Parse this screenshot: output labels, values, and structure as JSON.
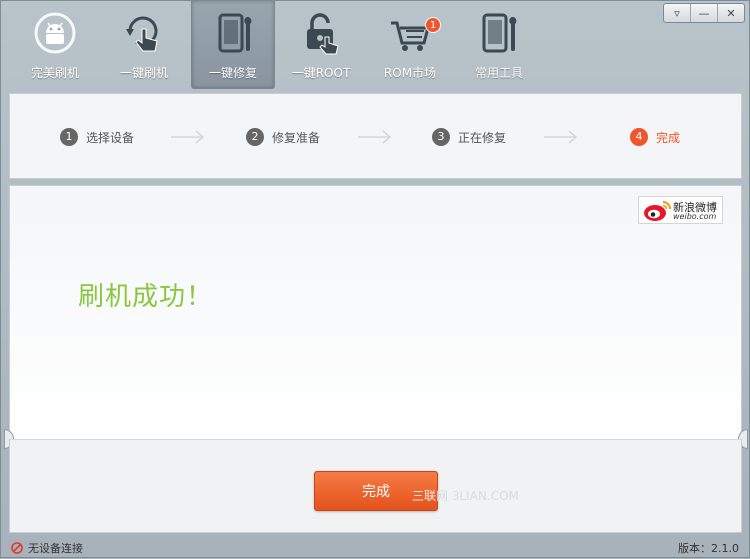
{
  "toolbar": {
    "items": [
      {
        "label": "完美刷机",
        "icon": "android-icon",
        "active": false
      },
      {
        "label": "一键刷机",
        "icon": "touch-refresh-icon",
        "active": false
      },
      {
        "label": "一键修复",
        "icon": "phone-repair-icon",
        "active": true
      },
      {
        "label": "一键ROOT",
        "icon": "unlock-icon",
        "active": false
      },
      {
        "label": "ROM市场",
        "icon": "cart-icon",
        "active": false,
        "badge": "1"
      },
      {
        "label": "常用工具",
        "icon": "tools-icon",
        "active": false
      }
    ]
  },
  "window_controls": {
    "menu": "▿",
    "minimize": "—",
    "close": "✕"
  },
  "steps": [
    {
      "num": "1",
      "label": "选择设备"
    },
    {
      "num": "2",
      "label": "修复准备"
    },
    {
      "num": "3",
      "label": "正在修复"
    },
    {
      "num": "4",
      "label": "完成",
      "current": true
    }
  ],
  "weibo": {
    "name": "新浪微博",
    "domain": "weibo.com"
  },
  "main": {
    "message": "刷机成功！"
  },
  "actions": {
    "done_label": "完成"
  },
  "watermark": {
    "brand": "三联",
    "site": "网 3LIAN.COM"
  },
  "status": {
    "connection": "无设备连接",
    "version": "版本：2.1.0"
  },
  "colors": {
    "accent": "#f0552b",
    "success": "#8cc63f"
  }
}
